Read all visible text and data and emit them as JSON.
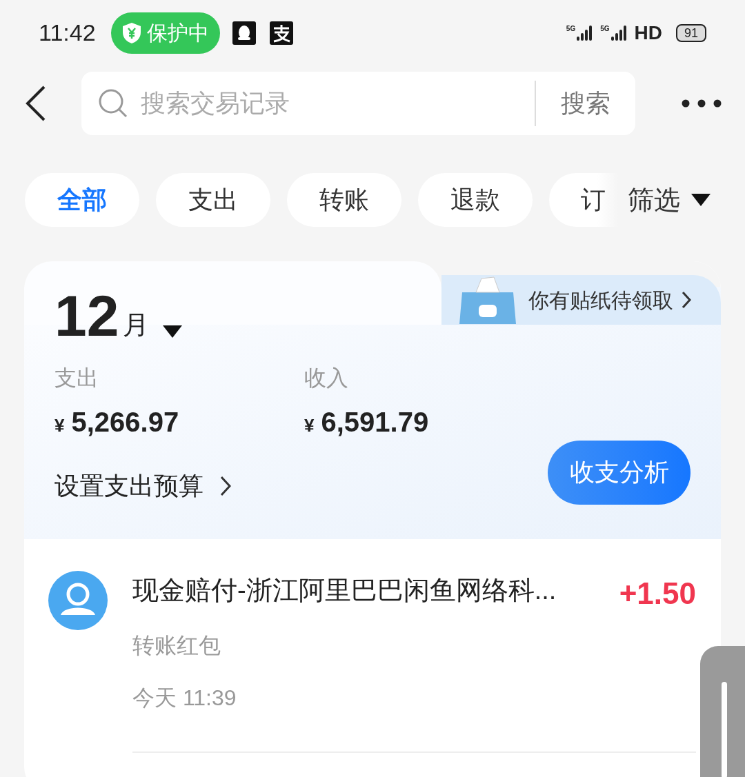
{
  "status_bar": {
    "time": "11:42",
    "protection_badge": "保护中",
    "signals": [
      {
        "label": "5G"
      },
      {
        "label": "5G"
      }
    ],
    "network": "HD",
    "battery": "91"
  },
  "search": {
    "placeholder": "搜索交易记录",
    "button": "搜索"
  },
  "tabs": [
    {
      "label": "全部",
      "selected": true
    },
    {
      "label": "支出",
      "selected": false
    },
    {
      "label": "转账",
      "selected": false
    },
    {
      "label": "退款",
      "selected": false
    },
    {
      "label": "订",
      "selected": false
    }
  ],
  "filter": "筛选",
  "summary": {
    "sticker_banner": "你有贴纸待领取",
    "month": "12",
    "month_unit": "月",
    "expense_label": "支出",
    "currency": "¥",
    "expense": "5,266.97",
    "income_label": "收入",
    "income": "6,591.79",
    "budget_link": "设置支出预算",
    "analysis_button": "收支分析"
  },
  "transactions": [
    {
      "title": "现金赔付-浙江阿里巴巴闲鱼网络科...",
      "amount": "+1.50",
      "category": "转账红包",
      "time": "今天 11:39"
    }
  ]
}
